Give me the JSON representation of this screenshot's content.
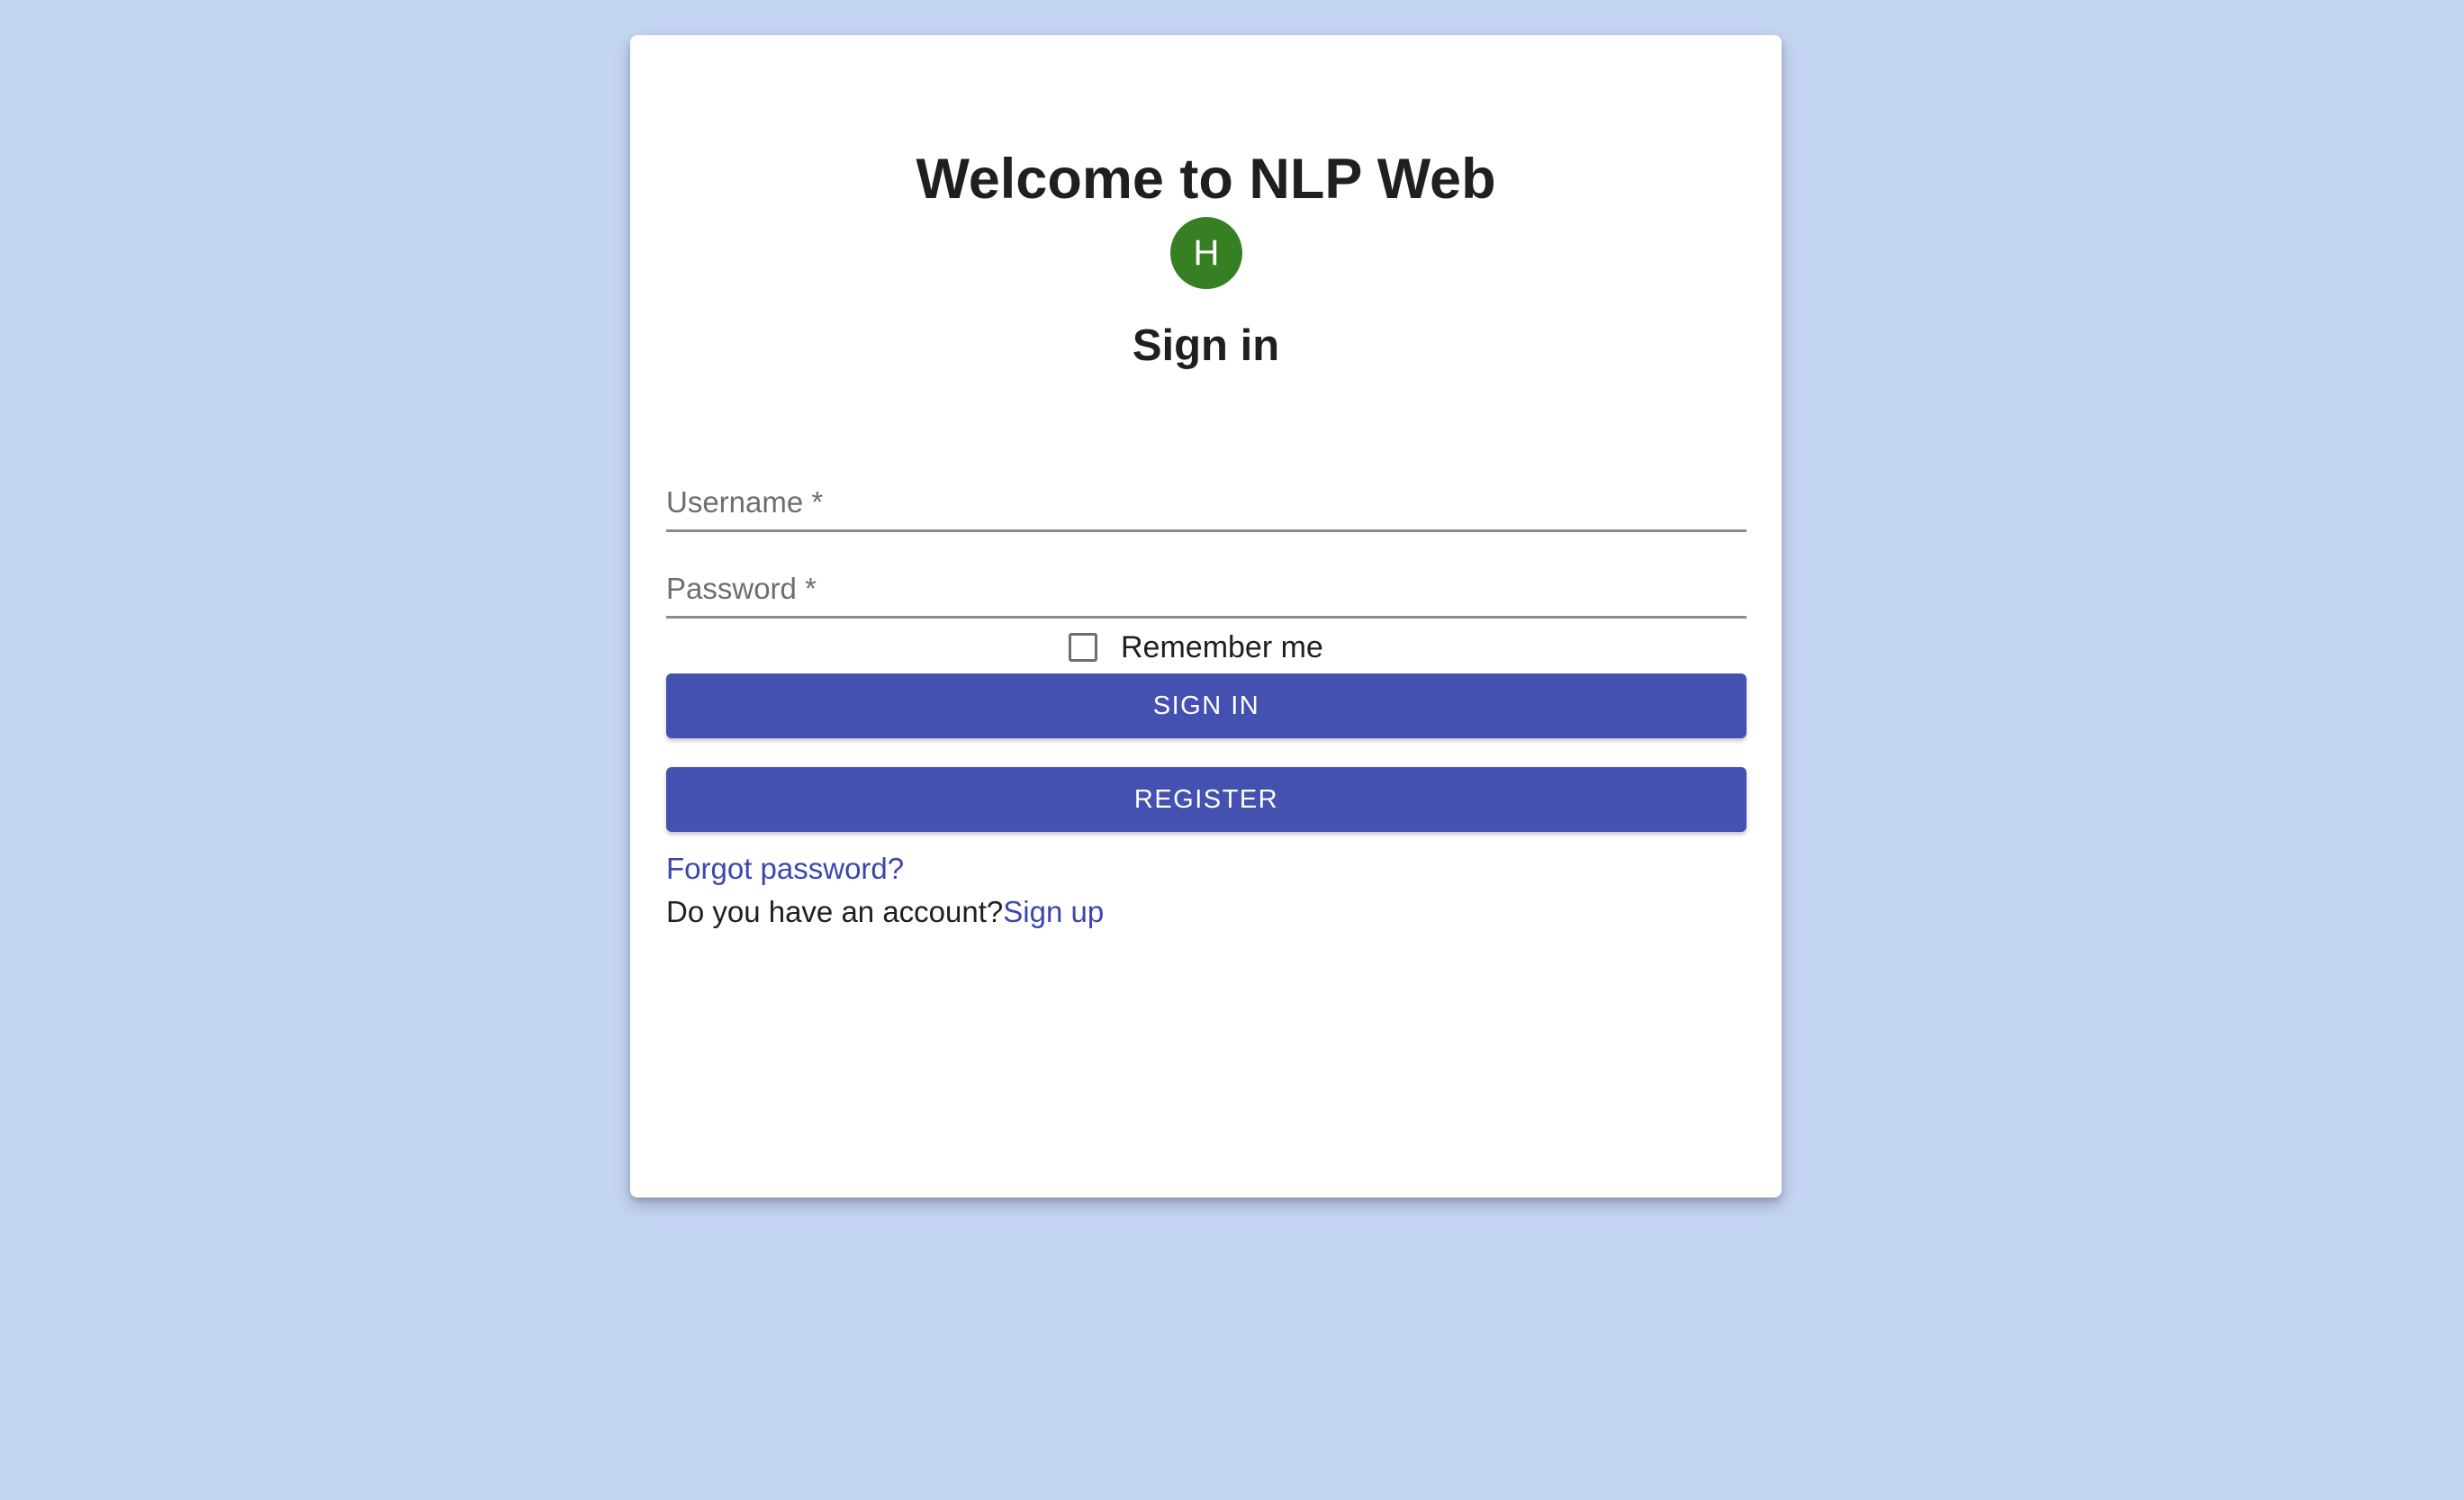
{
  "page": {
    "title": "Welcome to NLP Web",
    "avatar_letter": "H",
    "subtitle": "Sign in"
  },
  "form": {
    "username_label": "Username *",
    "password_label": "Password *",
    "remember_label": "Remember me",
    "remember_checked": false
  },
  "buttons": {
    "signin_label": "SIGN IN",
    "register_label": "REGISTER"
  },
  "links": {
    "forgot_label": "Forgot password?",
    "account_prompt": "Do you have an account?",
    "signup_label": "Sign up"
  },
  "colors": {
    "background": "#c4d5f2",
    "primary": "#4551b1",
    "avatar": "#367f23",
    "link": "#3b47b0"
  }
}
